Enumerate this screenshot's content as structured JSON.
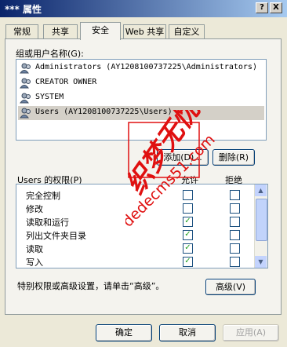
{
  "window": {
    "title": "*** 属性",
    "help_label": "?",
    "close_label": "X"
  },
  "tabs": [
    {
      "label": "常规",
      "active": false
    },
    {
      "label": "共享",
      "active": false
    },
    {
      "label": "安全",
      "active": true
    },
    {
      "label": "Web 共享",
      "active": false
    },
    {
      "label": "自定义",
      "active": false
    }
  ],
  "users": {
    "label": "组或用户名称(G):",
    "items": [
      {
        "name": "Administrators (AY1208100737225\\Administrators)",
        "selected": false
      },
      {
        "name": "CREATOR OWNER",
        "selected": false
      },
      {
        "name": "SYSTEM",
        "selected": false
      },
      {
        "name": "Users (AY1208100737225\\Users)",
        "selected": true
      }
    ],
    "add_label": "添加(D)...",
    "remove_label": "删除(R)"
  },
  "permissions": {
    "label": "Users 的权限(P)",
    "allow_header": "允许",
    "deny_header": "拒绝",
    "check_glyph": "✓",
    "rows": [
      {
        "name": "完全控制",
        "allow": false,
        "deny": false
      },
      {
        "name": "修改",
        "allow": false,
        "deny": false
      },
      {
        "name": "读取和运行",
        "allow": true,
        "deny": false
      },
      {
        "name": "列出文件夹目录",
        "allow": true,
        "deny": false
      },
      {
        "name": "读取",
        "allow": true,
        "deny": false
      },
      {
        "name": "写入",
        "allow": true,
        "deny": false
      },
      {
        "name": "特别的权限",
        "allow": false,
        "deny": false
      }
    ]
  },
  "advanced": {
    "hint": "特别权限或高级设置，请单击“高级”。",
    "button_label": "高级(V)"
  },
  "footer": {
    "ok_label": "确定",
    "cancel_label": "取消",
    "apply_label": "应用(A)"
  },
  "watermark": {
    "site": "dedecms51.com",
    "brand": "织梦无忧",
    "color": "#e01010"
  },
  "colors": {
    "titlebar_start": "#0a246a",
    "selection": "#d4d0c8",
    "check": "#21a121"
  }
}
